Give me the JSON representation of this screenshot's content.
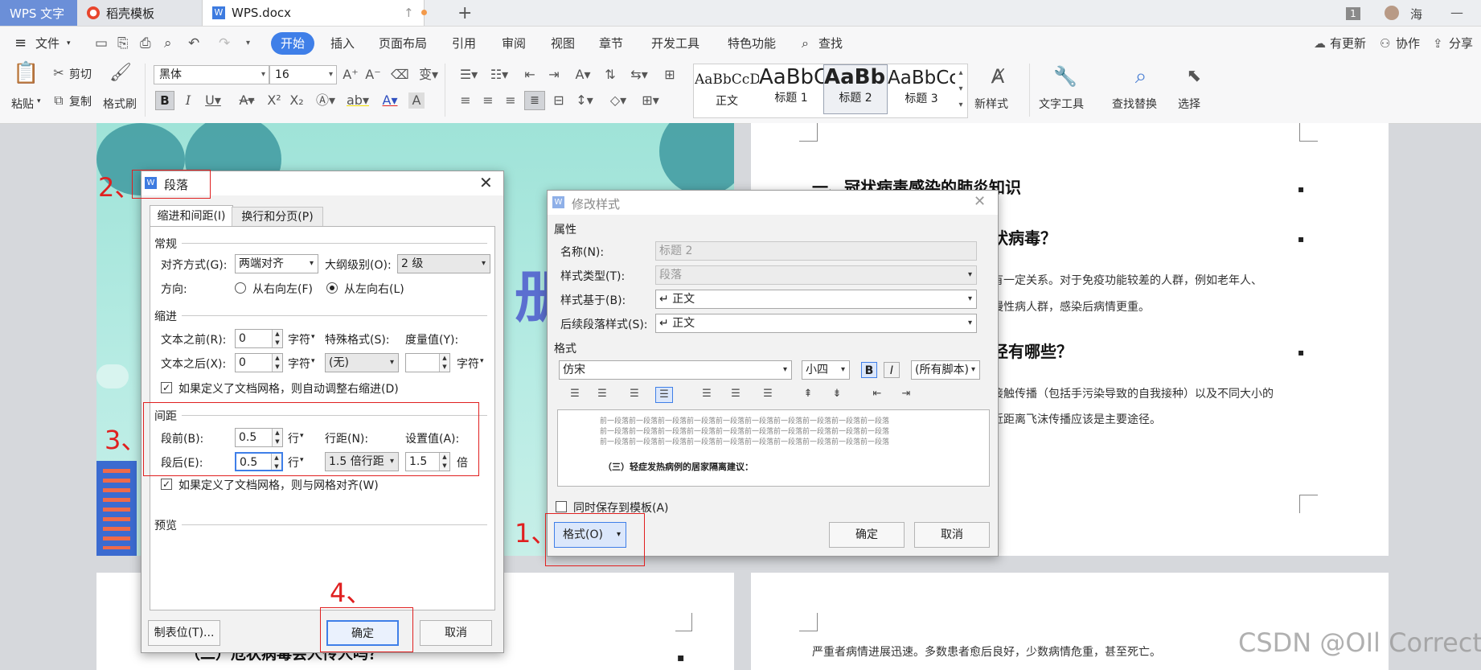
{
  "tabs": {
    "app_label": "WPS 文字",
    "template_tab": "稻壳模板",
    "doc_tab": "WPS.docx",
    "new_tab": "+",
    "badge": "1",
    "user": "海"
  },
  "menu": {
    "file": "文件",
    "items": [
      "开始",
      "插入",
      "页面布局",
      "引用",
      "审阅",
      "视图",
      "章节",
      "开发工具",
      "特色功能"
    ],
    "search": "查找",
    "update": "有更新",
    "collab": "协作",
    "share": "分享"
  },
  "ribbon": {
    "paste": "粘贴",
    "cut": "剪切",
    "copy": "复制",
    "format_painter": "格式刷",
    "font_name": "黑体",
    "font_size": "16",
    "styles": [
      {
        "preview": "AaBbCcDc",
        "label": "正文"
      },
      {
        "preview": "AaBbC",
        "label": "标题 1"
      },
      {
        "preview": "AaBb(",
        "label": "标题 2"
      },
      {
        "preview": "AaBbCc",
        "label": "标题 3"
      }
    ],
    "new_style": "新样式",
    "text_tools": "文字工具",
    "find_replace": "查找替换",
    "select": "选择"
  },
  "document": {
    "h1": "一、冠状病毒感染的肺炎知识",
    "h2": "状病毒？",
    "p1a": "有一定关系。对于免疫功能较差的人群，例如老年人、",
    "p1b": "慢性病人群，感染后病情更重。",
    "h3": "径有哪些？",
    "p2a": "接触传播（包括手污染导致的自我接种）以及不同大小的",
    "p2b": "近距离飞沫传播应该是主要途径。",
    "bottom_right": "严重者病情进展迅速。多数患者愈后良好，少数病情危重，甚至死亡。",
    "bottom_left": "（二）危状病毒会人传人吗？",
    "cover_char": "册",
    "watermark": "CSDN @OIl Correct"
  },
  "para_dialog": {
    "title": "段落",
    "tab1": "缩进和间距(I)",
    "tab2": "换行和分页(P)",
    "general": "常规",
    "align_label": "对齐方式(G):",
    "align_value": "两端对齐",
    "outline_label": "大纲级别(O):",
    "outline_value": "2 级",
    "direction_label": "方向:",
    "rtl": "从右向左(F)",
    "ltr": "从左向右(L)",
    "indent": "缩进",
    "before_text_label": "文本之前(R):",
    "before_text_value": "0",
    "after_text_label": "文本之后(X):",
    "after_text_value": "0",
    "unit_char": "字符",
    "special_label": "特殊格式(S):",
    "special_value": "(无)",
    "measure_label": "度量值(Y):",
    "measure_value": "",
    "grid_indent": "如果定义了文档网格，则自动调整右缩进(D)",
    "spacing": "间距",
    "before_label": "段前(B):",
    "before_value": "0.5",
    "after_label": "段后(E):",
    "after_value": "0.5",
    "unit_line": "行",
    "line_spacing_label": "行距(N):",
    "line_spacing_value": "1.5 倍行距",
    "set_value_label": "设置值(A):",
    "set_value": "1.5",
    "unit_times": "倍",
    "grid_align": "如果定义了文档网格，则与网格对齐(W)",
    "preview": "预览",
    "tabs_btn": "制表位(T)...",
    "ok": "确定",
    "cancel": "取消"
  },
  "style_dialog": {
    "title": "修改样式",
    "props": "属性",
    "name_label": "名称(N):",
    "name_value": "标题 2",
    "type_label": "样式类型(T):",
    "type_value": "段落",
    "based_label": "样式基于(B):",
    "based_value": "↵ 正文",
    "next_label": "后续段落样式(S):",
    "next_value": "↵ 正文",
    "format": "格式",
    "font_value": "仿宋",
    "size_value": "小四",
    "bold": "B",
    "italic": "I",
    "script_value": "(所有脚本)",
    "preview_prev": "前一段落前一段落前一段落前一段落前一段落前一段落前一段落前一段落前一段落前一段落",
    "preview_sample": "（三）轻症发热病例的居家隔离建议：",
    "save_template": "同时保存到模板(A)",
    "format_btn": "格式(O)",
    "ok": "确定",
    "cancel": "取消"
  },
  "annotations": [
    "1、",
    "2、",
    "3、",
    "4、"
  ]
}
